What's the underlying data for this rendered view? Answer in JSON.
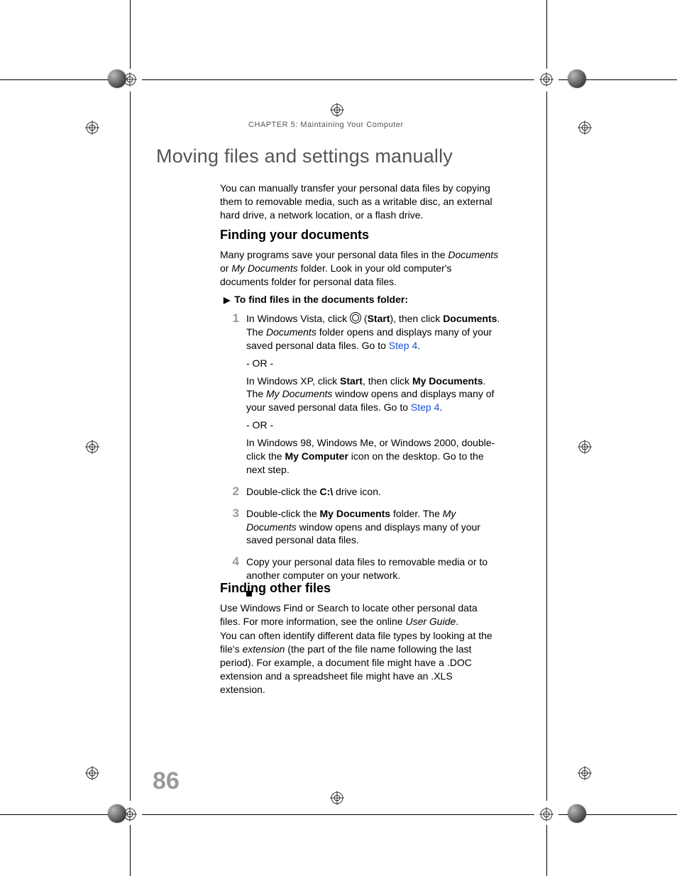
{
  "header": {
    "chapter_label": "CHAPTER",
    "chapter_number": "5",
    "chapter_title": ": Maintaining Your Computer"
  },
  "title": "Moving files and settings manually",
  "intro": "You can manually transfer your personal data files by copying them to removable media, such as a writable disc, an external hard drive, a network location, or a flash drive.",
  "section1": {
    "heading": "Finding your documents",
    "para": {
      "pre": "Many programs save your personal data files in the ",
      "ital1": "Documents",
      "mid1": " or ",
      "ital2": "My Documents",
      "post": " folder. Look in your old computer's documents folder for personal data files."
    },
    "procedure_heading": "To find files in the documents folder:",
    "steps": {
      "s1": {
        "num": "1",
        "vista_pre": "In Windows Vista, click ",
        "vista_start_open": " (",
        "vista_start": "Start",
        "vista_start_close": "), then click ",
        "vista_docs": "Documents",
        "vista_mid": ". The ",
        "vista_ital": "Documents",
        "vista_post": " folder opens and displays many of your saved personal data files. Go to ",
        "vista_link": "Step 4",
        "vista_dot": ".",
        "or": "- OR -",
        "xp_pre": "In Windows XP, click ",
        "xp_start": "Start",
        "xp_mid1": ", then click ",
        "xp_mydocs": "My Documents",
        "xp_mid2": ". The ",
        "xp_ital": "My Documents",
        "xp_post": " window opens and displays many of your saved personal data files. Go to ",
        "xp_link": "Step 4",
        "xp_dot": ".",
        "legacy_pre": "In Windows 98, Windows Me, or Windows 2000, double-click the ",
        "legacy_bold": "My Computer",
        "legacy_post": " icon on the desktop. Go to the next step."
      },
      "s2": {
        "num": "2",
        "pre": "Double-click the ",
        "bold": "C:\\",
        "post": " drive icon."
      },
      "s3": {
        "num": "3",
        "pre": "Double-click the ",
        "bold": "My Documents",
        "mid": " folder. The ",
        "ital": "My Documents",
        "post": " window opens and displays many of your saved personal data files."
      },
      "s4": {
        "num": "4",
        "text": "Copy your personal data files to removable media or to another computer on your network."
      }
    }
  },
  "section2": {
    "heading": "Finding other files",
    "para1": {
      "pre": "Use Windows Find or Search to locate other personal data files. For more information, see the online ",
      "ital": "User Guide",
      "post": "."
    },
    "para2": {
      "pre": "You can often identify different data file types by looking at the file's ",
      "ital": "extension",
      "post": " (the part of the file name following the last period). For example, a document file might have a .DOC extension and a spreadsheet file might have an .XLS extension."
    }
  },
  "page_number": "86"
}
